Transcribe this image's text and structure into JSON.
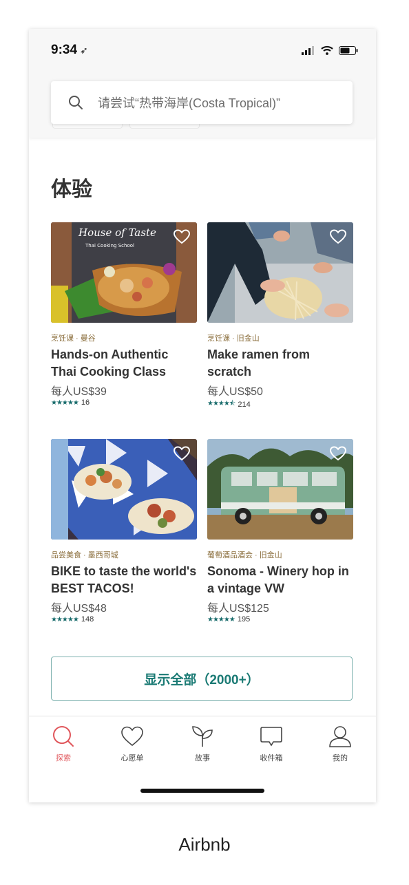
{
  "status": {
    "time": "9:34"
  },
  "search": {
    "placeholder": "请尝试“热带海岸(Costa Tropical)”"
  },
  "section": {
    "title": "体验"
  },
  "cards": [
    {
      "category": "烹饪课 · 曼谷",
      "title": "Hands-on Authentic Thai Cooking Class",
      "price": "每人US$39",
      "rating": 5,
      "reviews": "16",
      "image_text": [
        "House of Taste",
        "Thai Cooking School"
      ]
    },
    {
      "category": "烹饪课 · 旧金山",
      "title": "Make ramen from scratch",
      "price": "每人US$50",
      "rating": 4.5,
      "reviews": "214"
    },
    {
      "category": "品尝美食 · 墨西哥城",
      "title": "BIKE to taste the world's BEST TACOS!",
      "price": "每人US$48",
      "rating": 5,
      "reviews": "148"
    },
    {
      "category": "葡萄酒品酒会 · 旧金山",
      "title": "Sonoma - Winery hop in a vintage VW",
      "price": "每人US$125",
      "rating": 5,
      "reviews": "195"
    }
  ],
  "show_all": {
    "label": "显示全部（2000+）"
  },
  "tabs": [
    {
      "label": "探索",
      "icon": "search-icon",
      "active": true
    },
    {
      "label": "心愿单",
      "icon": "heart-icon",
      "active": false
    },
    {
      "label": "故事",
      "icon": "sprout-icon",
      "active": false
    },
    {
      "label": "收件箱",
      "icon": "chat-bubble-icon",
      "active": false
    },
    {
      "label": "我的",
      "icon": "user-icon",
      "active": false
    }
  ],
  "caption": "Airbnb",
  "colors": {
    "accent": "#e0565b",
    "teal": "#1a7a74",
    "category": "#8a6d3b"
  }
}
